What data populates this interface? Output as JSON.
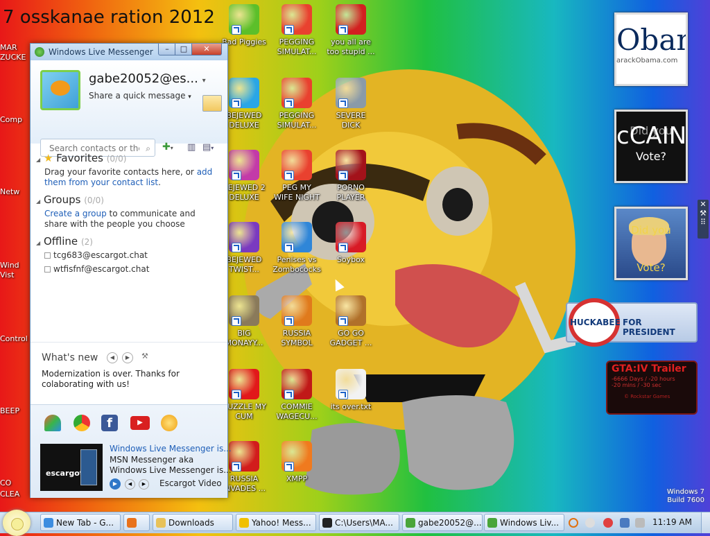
{
  "desktop": {
    "top_text": "7 osskanae ration 2012",
    "left_labels": [
      "MAR",
      "ZUCKE",
      "Comp",
      "Netw",
      "Wind",
      "Vist",
      "Control",
      "BEEP",
      "CO",
      "CLEA"
    ],
    "icons": [
      {
        "label": "Bad Piggies",
        "icon": "pig-icon",
        "color": "#5cbf2a"
      },
      {
        "label": "PEGGING SIMULAT...",
        "icon": "peg-p-icon",
        "color": "#e9412f"
      },
      {
        "label": "you all are too stupid ...",
        "icon": "dev-cpp-icon",
        "color": "#d22020"
      },
      {
        "label": "BEJEWED DELUXE",
        "icon": "gem-icon",
        "color": "#29a6e6"
      },
      {
        "label": "PEGGING SIMULAT...",
        "icon": "peg-p-icon",
        "color": "#e9412f"
      },
      {
        "label": "SEVERE DICK",
        "icon": "gear-sd-icon",
        "color": "#8a9aa8"
      },
      {
        "label": "BEJEWED 2 DELUXE",
        "icon": "gem-2-icon",
        "color": "#c33aa8"
      },
      {
        "label": "PEG MY WIFE NIGHT",
        "icon": "peg-p-icon",
        "color": "#e9412f"
      },
      {
        "label": "PORNO PLAYER",
        "icon": "flash-icon",
        "color": "#a3121a"
      },
      {
        "label": "BEJEWED TWIST...",
        "icon": "gem-twist-icon",
        "color": "#7a3ac0"
      },
      {
        "label": "Penises vs Zombococks",
        "icon": "phone-icon",
        "color": "#2f86d8"
      },
      {
        "label": "Soybox",
        "icon": "soybox-icon",
        "color": "#d81a25"
      },
      {
        "label": "BIG MONAYY...",
        "icon": "money-bag-icon",
        "color": "#8a7a5a"
      },
      {
        "label": "RUSSIA SYMBOL",
        "icon": "puzzle-icon",
        "color": "#e07a1c"
      },
      {
        "label": "GO GO GADGET ...",
        "icon": "briefcase-icon",
        "color": "#b0702a"
      },
      {
        "label": "HUZZLE MY CUM",
        "icon": "red-ball-icon",
        "color": "#e2181a"
      },
      {
        "label": "COMMIE WAGECU...",
        "icon": "flag-icon",
        "color": "#c01818"
      },
      {
        "label": "its over.txt",
        "icon": "text-file-icon",
        "color": "#f2f2f2"
      },
      {
        "label": "RUSSIA INVADES ...",
        "icon": "radiation-icon",
        "color": "#d21c1c"
      },
      {
        "label": "XMPP",
        "icon": "xampp-icon",
        "color": "#f07a1e"
      }
    ]
  },
  "gadgets": {
    "obama": "Obama",
    "obama_sub": "arackObama.com",
    "mccain_top": "Did you",
    "mccain_main": "cCAIN",
    "mccain_bottom": "Vote?",
    "hillary_top": "Did you",
    "hillary_bottom": "Vote?",
    "huckabee": "HUCKABEE",
    "huckabee_tag": "FOR PRESIDENT",
    "gta_title": "GTA:IV Trailer",
    "gta_line1": "-6666 Days  /  -20 hours",
    "gta_line2": "-20 mins  /  -30 sec",
    "gta_footer": "© Rockstar Games"
  },
  "messenger": {
    "title": "Windows Live Messenger",
    "username": "gabe20052@es...",
    "status": "Share a quick message",
    "search_placeholder": "Search contacts or the ...",
    "favorites": {
      "title": "Favorites",
      "count": "(0/0)",
      "desc": "Drag your favorite contacts here, or ",
      "link": "add them from your contact list",
      "end": "."
    },
    "groups": {
      "title": "Groups",
      "count": "(0/0)",
      "link": "Create a group",
      "desc": " to communicate and share with the people you choose"
    },
    "offline": {
      "title": "Offline",
      "count": "(2)",
      "contacts": [
        "tcg683@escargot.chat",
        "wtfisfnf@escargot.chat"
      ]
    },
    "whats_new": {
      "title": "What's new",
      "text": "Modernization is over. Thanks for colaborating with us!"
    },
    "news": {
      "headline": "Windows Live Messenger is...",
      "line1": "MSN Messenger aka",
      "line2": "Windows Live Messenger is...",
      "source": "Escargot Video",
      "thumb": "escargot"
    }
  },
  "taskbar": {
    "buttons": [
      {
        "label": "New Tab - G...",
        "icon": "chrome-icon",
        "color": "#3c8de0"
      },
      {
        "label": "",
        "icon": "firefox-icon",
        "color": "#e8721c"
      },
      {
        "label": "Downloads",
        "icon": "folder-icon",
        "color": "#e8c25a"
      },
      {
        "label": "Yahoo! Mess...",
        "icon": "yahoo-icon",
        "color": "#f0c000"
      },
      {
        "label": "C:\\Users\\MA...",
        "icon": "cmd-icon",
        "color": "#222222"
      },
      {
        "label": "gabe20052@...",
        "icon": "messenger-icon",
        "color": "#4aa53a"
      },
      {
        "label": "Windows Liv...",
        "icon": "messenger-icon",
        "color": "#4aa53a"
      }
    ],
    "clock": "11:19 AM",
    "watermark_line1": "Windows 7",
    "watermark_line2": "Build 7600"
  },
  "colors": {
    "link": "#1f5fb8",
    "accent": "#7ccf4a"
  }
}
